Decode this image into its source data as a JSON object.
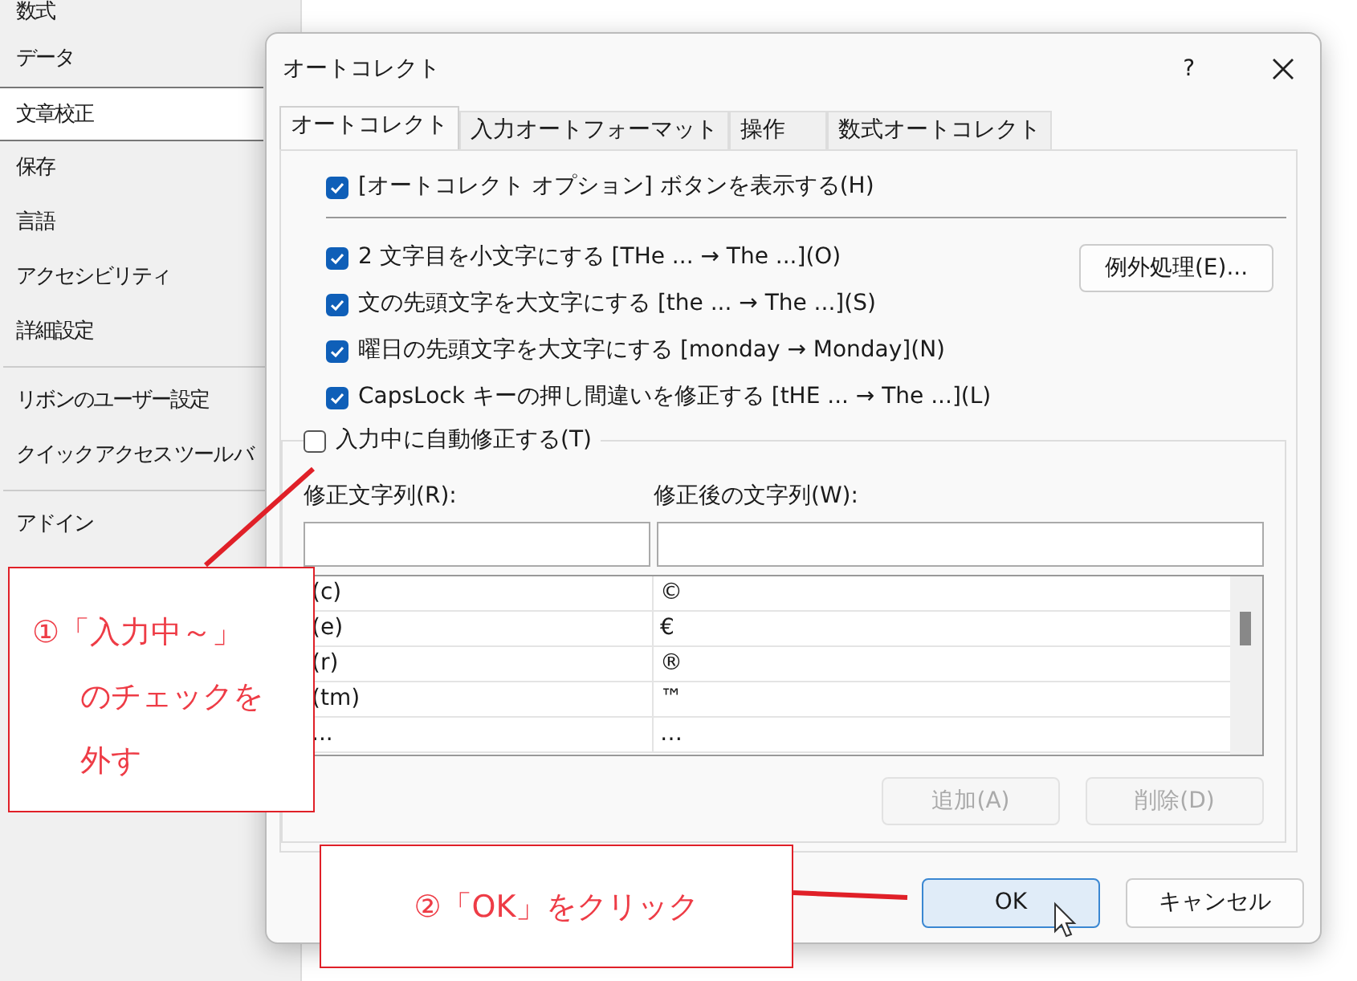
{
  "sidebar": {
    "groups": [
      [
        {
          "label": "数式",
          "selected": false
        },
        {
          "label": "データ",
          "selected": false
        },
        {
          "label": "文章校正",
          "selected": true
        },
        {
          "label": "保存",
          "selected": false
        },
        {
          "label": "言語",
          "selected": false
        },
        {
          "label": "アクセシビリティ",
          "selected": false
        },
        {
          "label": "詳細設定",
          "selected": false
        }
      ],
      [
        {
          "label": "リボンのユーザー設定",
          "selected": false
        },
        {
          "label": "クイック アクセス ツール バ",
          "selected": false
        }
      ],
      [
        {
          "label": "アドイン",
          "selected": false
        }
      ]
    ]
  },
  "dialog": {
    "title": "オートコレクト",
    "help_button": "?",
    "tabs": [
      {
        "label": "オートコレクト",
        "selected": true
      },
      {
        "label": "入力オートフォーマット",
        "selected": false
      },
      {
        "label": "操作",
        "selected": false
      },
      {
        "label": "数式オートコレクト",
        "selected": false
      }
    ],
    "show_options_button": {
      "label": "[オートコレクト オプション] ボタンを表示する(H)",
      "checked": true
    },
    "options": [
      {
        "label": "2 文字目を小文字にする [THe ... → The ...](O)",
        "checked": true
      },
      {
        "label": "文の先頭文字を大文字にする [the ... → The ...](S)",
        "checked": true
      },
      {
        "label": "曜日の先頭文字を大文字にする [monday → Monday](N)",
        "checked": true
      },
      {
        "label": "CapsLock キーの押し間違いを修正する [tHE ... → The ...](L)",
        "checked": true
      }
    ],
    "exceptions_button": "例外処理(E)...",
    "replace_as_you_type": {
      "label": "入力中に自動修正する(T)",
      "checked": false
    },
    "replace_label": "修正文字列(R):",
    "with_label": "修正後の文字列(W):",
    "rows": [
      {
        "replace": "(c)",
        "with": "©"
      },
      {
        "replace": "(e)",
        "with": "€"
      },
      {
        "replace": "(r)",
        "with": "®"
      },
      {
        "replace": "(tm)",
        "with": "™"
      },
      {
        "replace": "...",
        "with": "…"
      }
    ],
    "add_button": {
      "label": "追加(A)",
      "disabled": true
    },
    "delete_button": {
      "label": "削除(D)",
      "disabled": true
    },
    "ok_button": {
      "label": "OK",
      "hovered": true
    },
    "cancel_button": {
      "label": "キャンセル",
      "hovered": false
    }
  },
  "callouts": [
    {
      "lines": [
        "①「入力中～」",
        "のチェックを",
        "外す"
      ]
    },
    {
      "lines": [
        "②「OK」をクリック"
      ]
    }
  ]
}
